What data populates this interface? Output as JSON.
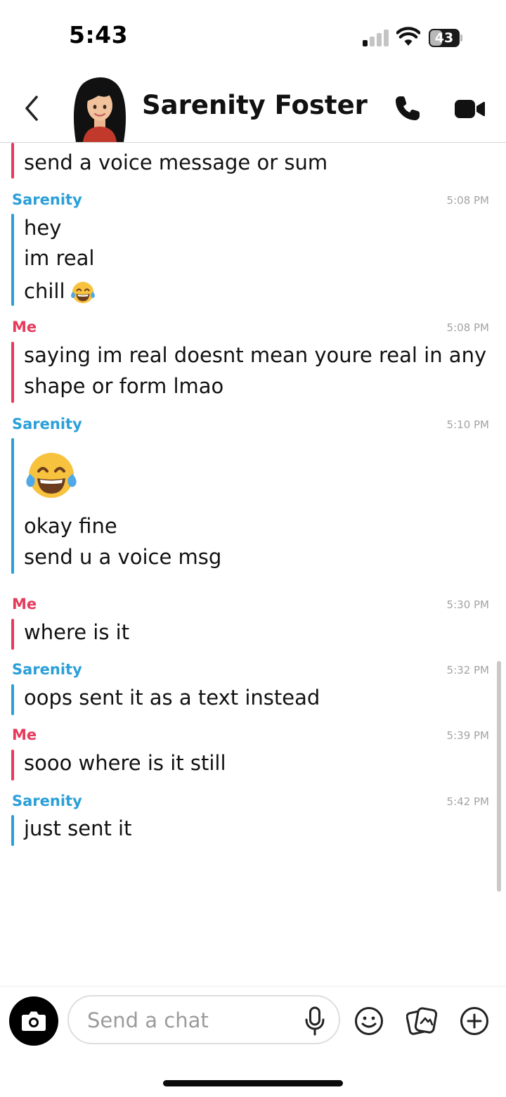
{
  "status_bar": {
    "time": "5:43",
    "battery": "43",
    "battery_level_percent": 43
  },
  "header": {
    "contact_name": "Sarenity Foster"
  },
  "messages": [
    {
      "lines": [
        "send a voice message or sum"
      ]
    },
    {
      "sender": "Sarenity",
      "time": "5:08 PM",
      "lines": [
        "hey",
        "im real",
        "chill"
      ],
      "emoji": "face-with-tears-of-joy"
    },
    {
      "sender": "Me",
      "time": "5:08 PM",
      "lines": [
        "saying im real doesnt mean youre real in any",
        "shape or form lmao"
      ]
    },
    {
      "sender": "Sarenity",
      "time": "5:10 PM",
      "emoji": "face-with-tears-of-joy",
      "lines": [
        "okay fine",
        "send u a voice msg"
      ]
    },
    {
      "sender": "Me",
      "time": "5:30 PM",
      "lines": [
        "where is it"
      ]
    },
    {
      "sender": "Sarenity",
      "time": "5:32 PM",
      "lines": [
        "oops sent it as a text instead"
      ]
    },
    {
      "sender": "Me",
      "time": "5:39 PM",
      "lines": [
        "sooo where is it still"
      ]
    },
    {
      "sender": "Sarenity",
      "time": "5:42 PM",
      "lines": [
        "just sent it"
      ]
    }
  ],
  "composer": {
    "placeholder": "Send a chat"
  },
  "colors": {
    "me": "#e63b5c",
    "friend": "#2a9fd8",
    "timestamp": "#a3a3a3"
  }
}
